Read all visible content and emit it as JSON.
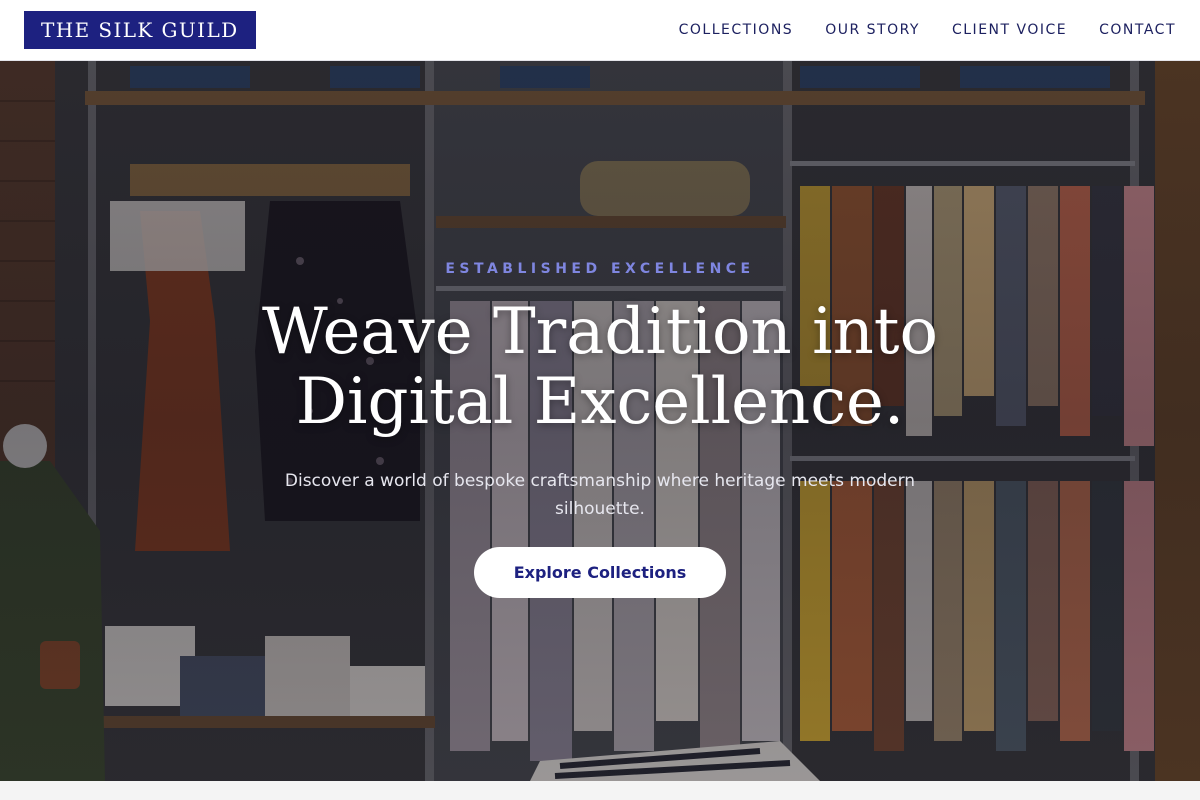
{
  "header": {
    "logo": "THE SILK GUILD",
    "nav": [
      {
        "label": "COLLECTIONS"
      },
      {
        "label": "OUR STORY"
      },
      {
        "label": "CLIENT VOICE"
      },
      {
        "label": "CONTACT"
      }
    ]
  },
  "hero": {
    "eyebrow": "ESTABLISHED EXCELLENCE",
    "headline_line1": "Weave Tradition into",
    "headline_line2": "Digital Excellence.",
    "subtext": "Discover a world of bespoke craftsmanship where heritage meets modern silhouette.",
    "cta_label": "Explore Collections",
    "background_image": "clothing-store-rack-photo"
  },
  "colors": {
    "brand": "#1d2180",
    "nav_text": "#1d2160",
    "eyebrow": "#7f86e0",
    "headline": "#ffffff"
  }
}
